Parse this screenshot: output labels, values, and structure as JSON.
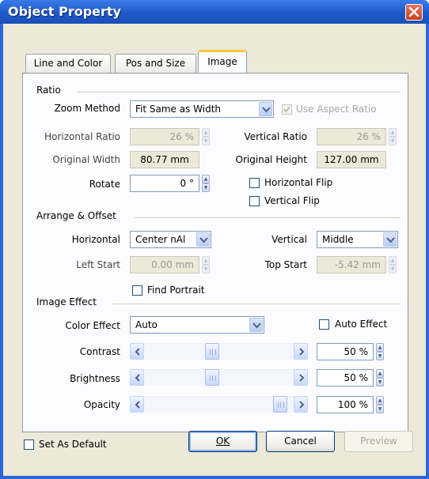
{
  "window": {
    "title": "Object Property"
  },
  "tabs": [
    {
      "label": "Line and Color"
    },
    {
      "label": "Pos and Size"
    },
    {
      "label": "Image"
    }
  ],
  "ratio": {
    "group_title": "Ratio",
    "zoom_method_label": "Zoom Method",
    "zoom_method_value": "Fit Same as Width",
    "use_aspect_ratio_label": "Use Aspect Ratio",
    "horizontal_ratio_label": "Horizontal Ratio",
    "horizontal_ratio_value": "26 %",
    "vertical_ratio_label": "Vertical Ratio",
    "vertical_ratio_value": "26 %",
    "original_width_label": "Original Width",
    "original_width_value": "80.77 mm",
    "original_height_label": "Original Height",
    "original_height_value": "127.00 mm",
    "rotate_label": "Rotate",
    "rotate_value": "0 °",
    "horizontal_flip_label": "Horizontal Flip",
    "vertical_flip_label": "Vertical Flip"
  },
  "arrange": {
    "group_title": "Arrange & Offset",
    "horizontal_label": "Horizontal",
    "horizontal_value": "Center nAl",
    "vertical_label": "Vertical",
    "vertical_value": "Middle",
    "left_start_label": "Left Start",
    "left_start_value": "0.00 mm",
    "top_start_label": "Top Start",
    "top_start_value": "-5.42 mm",
    "find_portrait_label": "Find Portrait"
  },
  "effect": {
    "group_title": "Image Effect",
    "color_effect_label": "Color Effect",
    "color_effect_value": "Auto",
    "auto_effect_label": "Auto Effect",
    "contrast_label": "Contrast",
    "contrast_value": "50 %",
    "contrast_level": 0.5,
    "brightness_label": "Brightness",
    "brightness_value": "50 %",
    "brightness_level": 0.5,
    "opacity_label": "Opacity",
    "opacity_value": "100 %",
    "opacity_level": 1.0
  },
  "footer": {
    "set_as_default_label": "Set As Default",
    "ok_label": "OK",
    "cancel_label": "Cancel",
    "preview_label": "Preview"
  }
}
